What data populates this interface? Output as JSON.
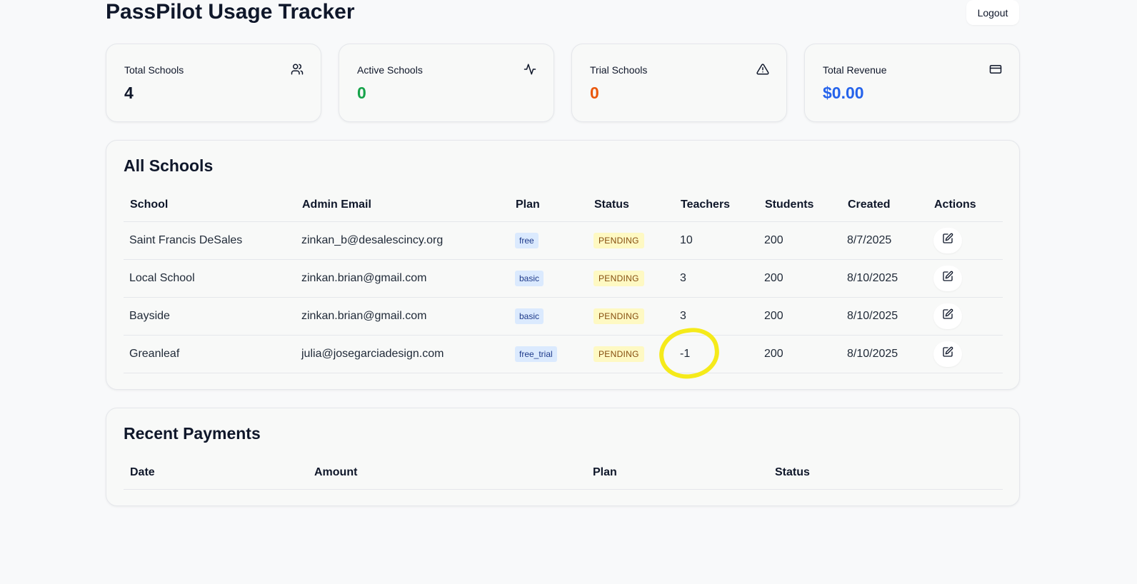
{
  "header": {
    "title": "PassPilot Usage Tracker",
    "logout_label": "Logout"
  },
  "stats": [
    {
      "label": "Total Schools",
      "value": "4",
      "icon": "users-icon",
      "color": "#0f172a"
    },
    {
      "label": "Active Schools",
      "value": "0",
      "icon": "activity-icon",
      "color": "#16a34a"
    },
    {
      "label": "Trial Schools",
      "value": "0",
      "icon": "alert-triangle-icon",
      "color": "#ea580c"
    },
    {
      "label": "Total Revenue",
      "value": "$0.00",
      "icon": "credit-card-icon",
      "color": "#2563eb"
    }
  ],
  "schools": {
    "title": "All Schools",
    "columns": [
      "School",
      "Admin Email",
      "Plan",
      "Status",
      "Teachers",
      "Students",
      "Created",
      "Actions"
    ],
    "rows": [
      {
        "school": "Saint Francis DeSales",
        "email": "zinkan_b@desalescincy.org",
        "plan": "free",
        "status": "PENDING",
        "teachers": "10",
        "students": "200",
        "created": "8/7/2025"
      },
      {
        "school": "Local School",
        "email": "zinkan.brian@gmail.com",
        "plan": "basic",
        "status": "PENDING",
        "teachers": "3",
        "students": "200",
        "created": "8/10/2025"
      },
      {
        "school": "Bayside",
        "email": "zinkan.brian@gmail.com",
        "plan": "basic",
        "status": "PENDING",
        "teachers": "3",
        "students": "200",
        "created": "8/10/2025"
      },
      {
        "school": "Greanleaf",
        "email": "julia@josegarciadesign.com",
        "plan": "free_trial",
        "status": "PENDING",
        "teachers": "-1",
        "students": "200",
        "created": "8/10/2025"
      }
    ]
  },
  "payments": {
    "title": "Recent Payments",
    "columns": [
      "Date",
      "Amount",
      "Plan",
      "Status"
    ]
  },
  "colors": {
    "highlight": "#f5ea1a"
  }
}
